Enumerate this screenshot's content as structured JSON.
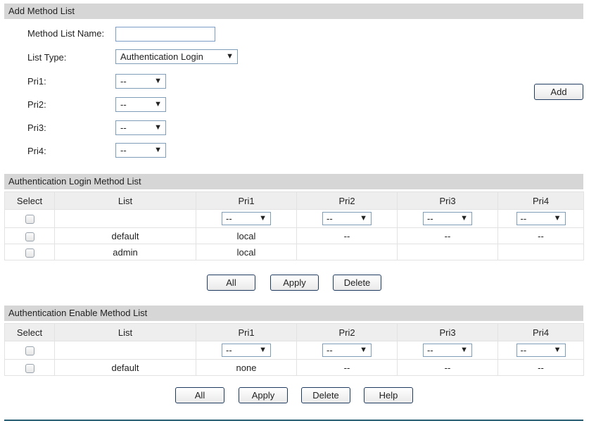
{
  "add_section": {
    "title": "Add Method List",
    "name_label": "Method List Name:",
    "name_value": "",
    "type_label": "List Type:",
    "type_value": "Authentication Login",
    "pri1_label": "Pri1:",
    "pri2_label": "Pri2:",
    "pri3_label": "Pri3:",
    "pri4_label": "Pri4:",
    "pri1_value": "--",
    "pri2_value": "--",
    "pri3_value": "--",
    "pri4_value": "--",
    "add_button": "Add"
  },
  "login_section": {
    "title": "Authentication Login Method List",
    "columns": [
      "Select",
      "List",
      "Pri1",
      "Pri2",
      "Pri3",
      "Pri4"
    ],
    "filter_values": [
      "--",
      "--",
      "--",
      "--"
    ],
    "rows": [
      {
        "list": "default",
        "pri1": "local",
        "pri2": "--",
        "pri3": "--",
        "pri4": "--"
      },
      {
        "list": "admin",
        "pri1": "local",
        "pri2": "",
        "pri3": "",
        "pri4": ""
      }
    ],
    "buttons": {
      "all": "All",
      "apply": "Apply",
      "delete": "Delete"
    }
  },
  "enable_section": {
    "title": "Authentication Enable Method List",
    "columns": [
      "Select",
      "List",
      "Pri1",
      "Pri2",
      "Pri3",
      "Pri4"
    ],
    "filter_values": [
      "--",
      "--",
      "--",
      "--"
    ],
    "rows": [
      {
        "list": "default",
        "pri1": "none",
        "pri2": "--",
        "pri3": "--",
        "pri4": "--"
      }
    ],
    "buttons": {
      "all": "All",
      "apply": "Apply",
      "delete": "Delete",
      "help": "Help"
    }
  },
  "icons": {
    "dropdown_arrow": "▼"
  }
}
